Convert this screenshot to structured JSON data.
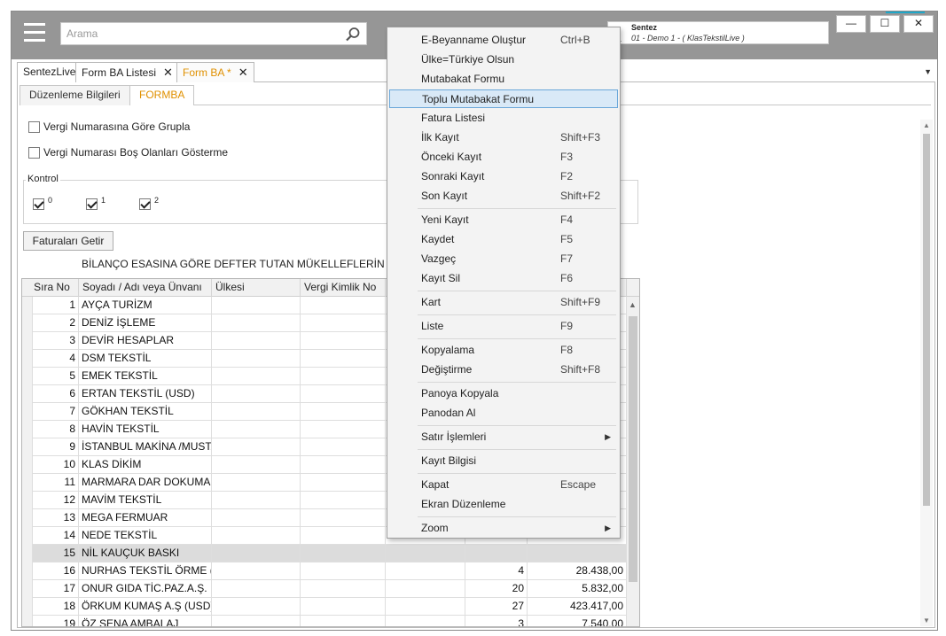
{
  "search": {
    "placeholder": "Arama"
  },
  "user": {
    "name": "Sentez",
    "company": "01 - Demo 1 - ( KlasTekstilLive )"
  },
  "window_buttons": {
    "minimize": "—",
    "maximize": "☐",
    "close": "✕"
  },
  "tabs": [
    {
      "label": "SentezLive",
      "closable": false,
      "active": false
    },
    {
      "label": "Form BA Listesi",
      "closable": true,
      "active": false
    },
    {
      "label": "Form BA *",
      "closable": true,
      "active": true
    }
  ],
  "tab_close_glyph": "✕",
  "tab_dropdown_glyph": "▼",
  "subtabs": [
    {
      "label": "Düzenleme Bilgileri",
      "active": false
    },
    {
      "label": "FORMBA",
      "active": true
    }
  ],
  "form": {
    "group_by_tax": "Vergi Numarasına Göre Grupla",
    "hide_empty_tax": "Vergi Numarası Boş Olanları Gösterme",
    "kontrol_label": "Kontrol",
    "kontrol_options": [
      "0",
      "1",
      "2"
    ],
    "fetch_button": "Faturaları Getir",
    "report_title": "BİLANÇO ESASINA GÖRE DEFTER TUTAN MÜKELLEFLERİN MAL V"
  },
  "grid": {
    "columns": [
      "Sıra No",
      "Soyadı / Adı veya Ünvanı",
      "Ülkesi",
      "Vergi Kimlik No"
    ],
    "rows": [
      {
        "no": "1",
        "name": "AYÇA TURİZM",
        "count": "",
        "amount": ""
      },
      {
        "no": "2",
        "name": "DENİZ İŞLEME",
        "count": "",
        "amount": ""
      },
      {
        "no": "3",
        "name": "DEVİR HESAPLAR",
        "count": "",
        "amount": ""
      },
      {
        "no": "4",
        "name": "DSM TEKSTİL",
        "count": "",
        "amount": ""
      },
      {
        "no": "5",
        "name": "EMEK TEKSTİL",
        "count": "",
        "amount": ""
      },
      {
        "no": "6",
        "name": "ERTAN TEKSTİL (USD)",
        "count": "",
        "amount": ""
      },
      {
        "no": "7",
        "name": "GÖKHAN TEKSTİL",
        "count": "",
        "amount": ""
      },
      {
        "no": "8",
        "name": "HAVİN TEKSTİL",
        "count": "",
        "amount": ""
      },
      {
        "no": "9",
        "name": "İSTANBUL MAKİNA /MUSTA",
        "count": "",
        "amount": ""
      },
      {
        "no": "10",
        "name": "KLAS DİKİM",
        "count": "",
        "amount": ""
      },
      {
        "no": "11",
        "name": "MARMARA DAR DOKUMA",
        "count": "",
        "amount": ""
      },
      {
        "no": "12",
        "name": "MAVİM TEKSTİL",
        "count": "",
        "amount": ""
      },
      {
        "no": "13",
        "name": "MEGA FERMUAR",
        "count": "",
        "amount": ""
      },
      {
        "no": "14",
        "name": "NEDE TEKSTİL",
        "count": "",
        "amount": ""
      },
      {
        "no": "15",
        "name": "NİL KAUÇUK BASKI",
        "count": "",
        "amount": ""
      },
      {
        "no": "16",
        "name": "NURHAS TEKSTİL ÖRME (U",
        "count": "4",
        "amount": "28.438,00"
      },
      {
        "no": "17",
        "name": "ONUR GIDA TİC.PAZ.A.Ş.",
        "count": "20",
        "amount": "5.832,00"
      },
      {
        "no": "18",
        "name": "ÖRKUM KUMAŞ A.Ş (USD)",
        "count": "27",
        "amount": "423.417,00"
      },
      {
        "no": "19",
        "name": "ÖZ SENA AMBALAJ",
        "count": "3",
        "amount": "7.540,00"
      }
    ],
    "selected_row": 15
  },
  "context_menu": {
    "highlighted": "Toplu Mutabakat Formu",
    "groups": [
      [
        {
          "label": "E-Beyanname Oluştur",
          "shortcut": "Ctrl+B"
        },
        {
          "label": "Ülke=Türkiye Olsun",
          "shortcut": ""
        },
        {
          "label": "Mutabakat Formu",
          "shortcut": ""
        },
        {
          "label": "Toplu Mutabakat Formu",
          "shortcut": ""
        },
        {
          "label": "Fatura Listesi",
          "shortcut": ""
        },
        {
          "label": "İlk Kayıt",
          "shortcut": "Shift+F3"
        },
        {
          "label": "Önceki Kayıt",
          "shortcut": "F3"
        },
        {
          "label": "Sonraki Kayıt",
          "shortcut": "F2"
        },
        {
          "label": "Son Kayıt",
          "shortcut": "Shift+F2"
        }
      ],
      [
        {
          "label": "Yeni Kayıt",
          "shortcut": "F4"
        },
        {
          "label": "Kaydet",
          "shortcut": "F5"
        },
        {
          "label": "Vazgeç",
          "shortcut": "F7"
        },
        {
          "label": "Kayıt Sil",
          "shortcut": "F6"
        }
      ],
      [
        {
          "label": "Kart",
          "shortcut": "Shift+F9"
        }
      ],
      [
        {
          "label": "Liste",
          "shortcut": "F9"
        }
      ],
      [
        {
          "label": "Kopyalama",
          "shortcut": "F8"
        },
        {
          "label": "Değiştirme",
          "shortcut": "Shift+F8"
        }
      ],
      [
        {
          "label": "Panoya Kopyala",
          "shortcut": ""
        },
        {
          "label": "Panodan Al",
          "shortcut": ""
        }
      ],
      [
        {
          "label": "Satır İşlemleri",
          "shortcut": "",
          "submenu": true
        }
      ],
      [
        {
          "label": "Kayıt Bilgisi",
          "shortcut": ""
        }
      ],
      [
        {
          "label": "Kapat",
          "shortcut": "Escape"
        },
        {
          "label": "Ekran Düzenleme",
          "shortcut": ""
        }
      ],
      [
        {
          "label": "Zoom",
          "shortcut": "",
          "submenu": true
        }
      ]
    ]
  },
  "icons": {
    "menu": "hamburger-icon",
    "search": "search-icon",
    "user": "user-icon",
    "submenu": "chevron-right-icon"
  }
}
